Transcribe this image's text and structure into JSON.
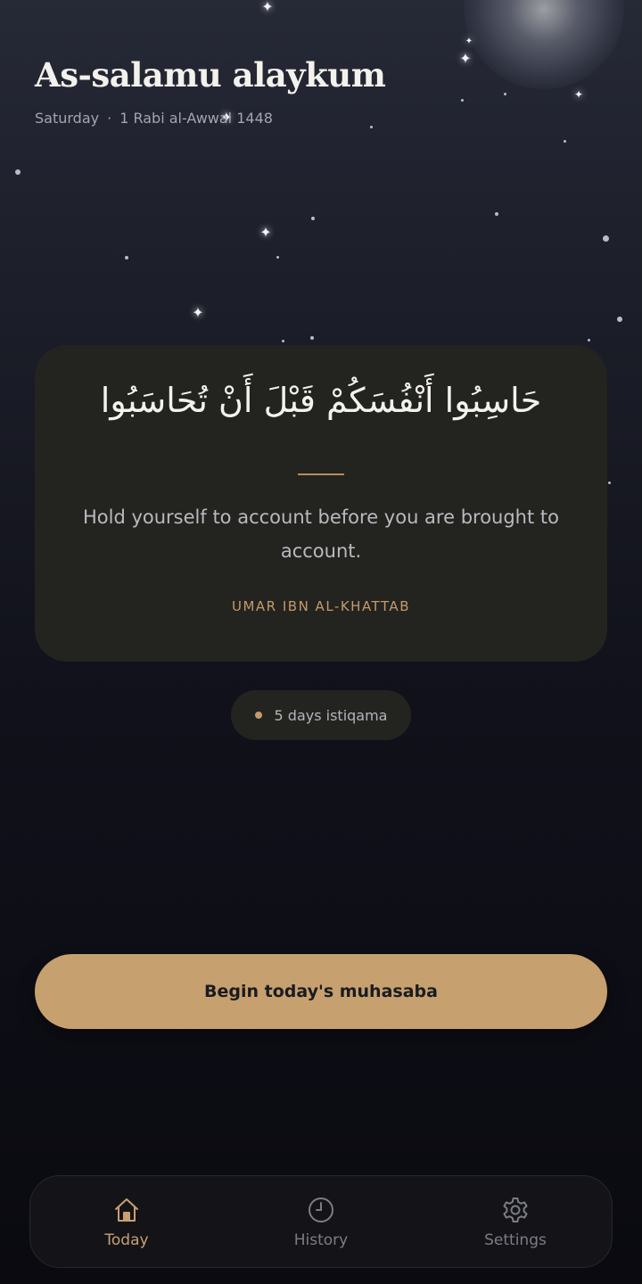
{
  "header": {
    "greeting": "As-salamu alaykum",
    "weekday": "Saturday",
    "separator": "·",
    "hijri_date": "1 Rabi al-Awwal 1448"
  },
  "quote": {
    "arabic": "حَاسِبُوا أَنْفُسَكُمْ قَبْلَ أَنْ تُحَاسَبُوا",
    "translation": "Hold yourself to account before you are brought to account.",
    "attribution": "UMAR IBN AL-KHATTAB"
  },
  "streak": {
    "label": "5 days istiqama"
  },
  "cta": {
    "label": "Begin today's muhasaba"
  },
  "nav": {
    "items": [
      {
        "label": "Today",
        "icon": "home-icon",
        "active": true
      },
      {
        "label": "History",
        "icon": "clock-icon",
        "active": false
      },
      {
        "label": "Settings",
        "icon": "gear-icon",
        "active": false
      }
    ]
  },
  "colors": {
    "accent": "#c6a06f",
    "card": "#23241f",
    "background": "#0b0b12"
  }
}
